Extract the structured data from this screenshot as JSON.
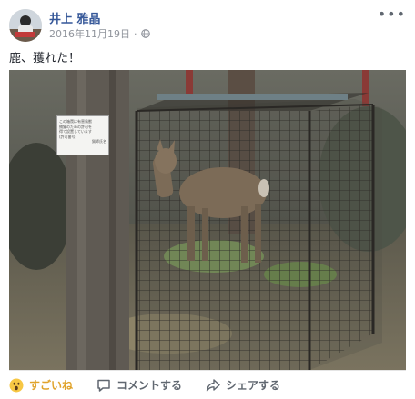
{
  "post": {
    "author": "井上 雅晶",
    "date": "2016年11月19日",
    "more_icon": "more-horizontal-icon",
    "audience_icon": "globe-icon",
    "message": "鹿、獲れた！"
  },
  "photo": {
    "sign_lines": [
      "この箱罠は有害鳥獣",
      "捕獲のための許可を",
      "得て設置しています",
      "(許可番号)",
      "猟師氏名"
    ]
  },
  "actions": {
    "reaction_label": "すごいね",
    "reaction_icon": "wow-emoji-icon",
    "comment_label": "コメントする",
    "comment_icon": "comment-icon",
    "share_label": "シェアする",
    "share_icon": "share-arrow-icon",
    "reaction_color": "#e0a32b"
  }
}
